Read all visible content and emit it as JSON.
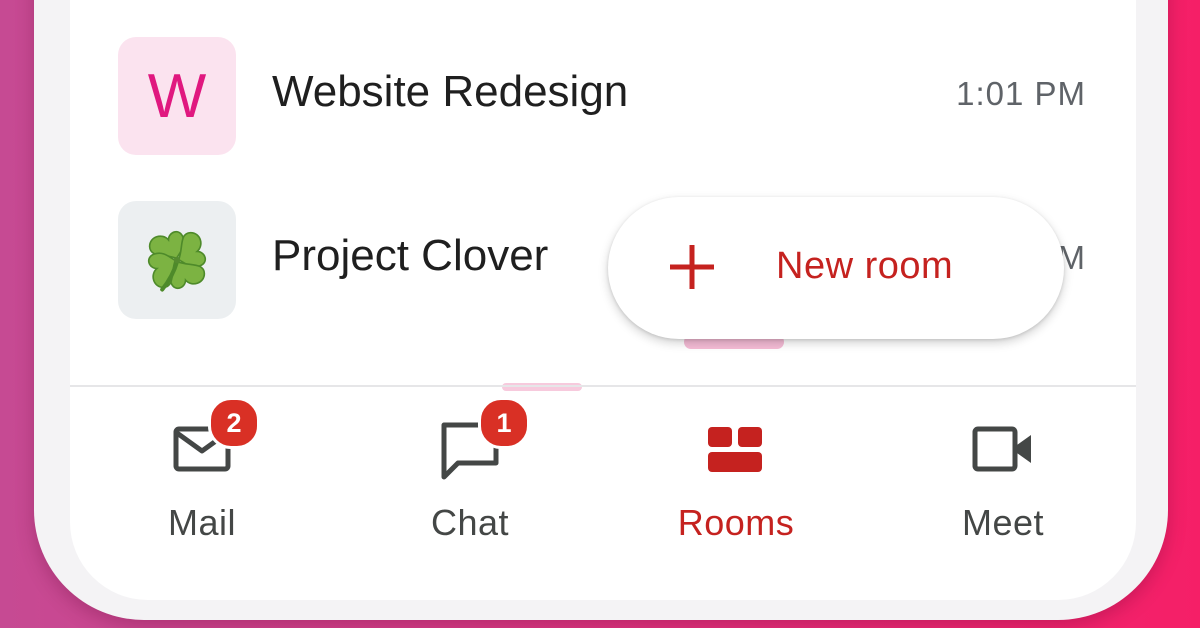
{
  "rooms": [
    {
      "avatar_letter": "W",
      "avatar_icon": "clover-icon",
      "name": "Website Redesign",
      "time": "1:01 PM"
    },
    {
      "avatar_icon": "four-leaf-clover-icon",
      "name": "Project Clover",
      "time_partial": "M"
    }
  ],
  "fab": {
    "icon": "plus-icon",
    "label": "New room"
  },
  "bottom_nav": {
    "mail": {
      "label": "Mail",
      "badge": "2",
      "icon": "mail-icon"
    },
    "chat": {
      "label": "Chat",
      "badge": "1",
      "icon": "chat-icon"
    },
    "rooms": {
      "label": "Rooms",
      "icon": "rooms-icon",
      "active": true
    },
    "meet": {
      "label": "Meet",
      "icon": "video-camera-icon"
    }
  },
  "colors": {
    "accent_red": "#c5221f",
    "badge_red": "#d93025",
    "avatar_pink": "#e0187f",
    "background_gradient_start": "#c64a93",
    "background_gradient_end": "#f51f67"
  }
}
